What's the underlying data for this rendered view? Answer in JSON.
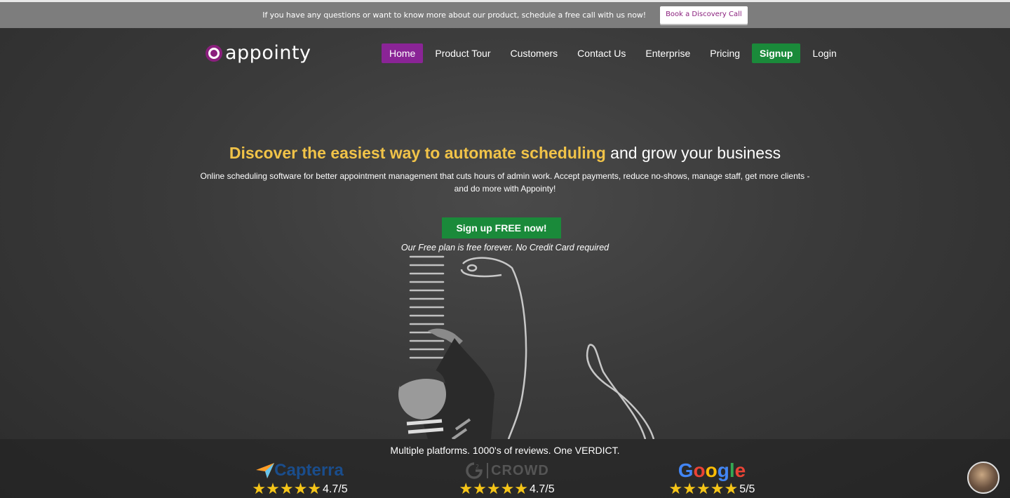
{
  "announcement": {
    "text": "If you have any questions or want to know more about our product, schedule a free call with us now!",
    "button_label": "Book a Discovery Call"
  },
  "brand": {
    "logo_text": "appointy",
    "logo_color": "#8a1f7d"
  },
  "nav": {
    "items": [
      {
        "label": "Home"
      },
      {
        "label": "Product Tour"
      },
      {
        "label": "Customers"
      },
      {
        "label": "Contact Us"
      },
      {
        "label": "Enterprise"
      },
      {
        "label": "Pricing"
      },
      {
        "label": "Signup"
      },
      {
        "label": "Login"
      }
    ],
    "active_color": "#8a2496",
    "signup_color": "#1a8a3a"
  },
  "hero": {
    "title_highlight": "Discover the easiest way to automate scheduling",
    "title_rest": " and grow your business",
    "highlight_color": "#f1c348",
    "subtitle": "Online scheduling software for better appointment management that cuts hours of admin work. Accept payments, reduce no-shows, manage staff, get more clients - and do more with Appointy!",
    "cta_label": "Sign up FREE now!",
    "cta_note": "Our Free plan is free forever. No Credit Card required"
  },
  "reviews": {
    "heading": "Multiple platforms. 1000's of reviews. One VERDICT.",
    "platforms": [
      {
        "name": "Capterra",
        "rating": 4.7,
        "score": "4.7/5"
      },
      {
        "name": "CROWD",
        "rating": 4.7,
        "score": "4.7/5"
      },
      {
        "name": "Google",
        "rating": 5,
        "score": "5/5"
      }
    ],
    "star_color": "#f5c518"
  },
  "icons": {
    "logo": "appointy-logo-icon",
    "capterra": "capterra-logo-icon",
    "g2": "g2-crowd-logo-icon",
    "google": "google-logo-icon",
    "chat": "chat-avatar-icon"
  }
}
